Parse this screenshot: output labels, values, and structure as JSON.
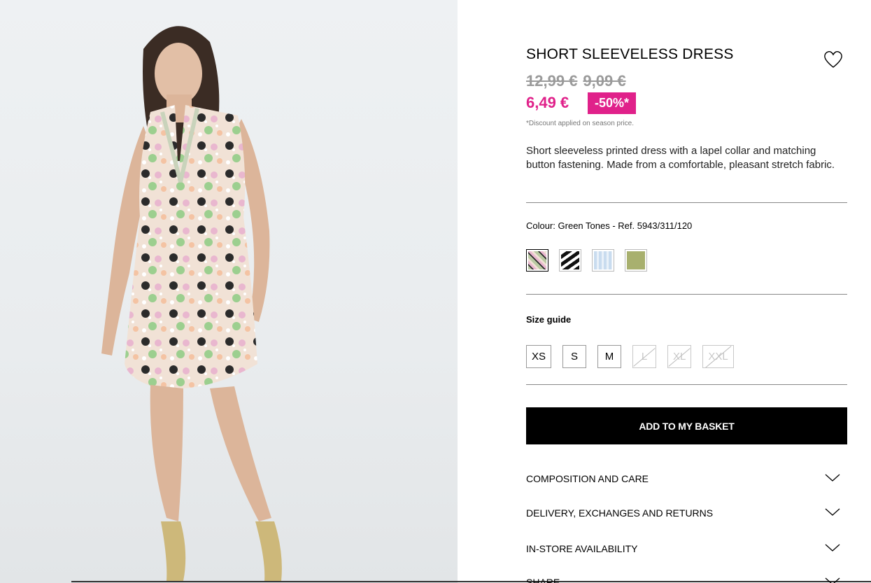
{
  "product": {
    "title": "SHORT SLEEVELESS DRESS",
    "old_price_1": "12,99 €",
    "old_price_2": "9,09 €",
    "price": "6,49 €",
    "discount": "-50%*",
    "discount_note": "*Discount applied on season price.",
    "description": "Short sleeveless printed dress with a lapel collar and matching button fastening. Made from a comfortable, pleasant stretch fabric.",
    "colour_line": "Colour: Green Tones - Ref. 5943/311/120",
    "swatches": [
      {
        "name": "Green Tones floral",
        "color": "#b9c9a2",
        "selected": true
      },
      {
        "name": "Black and white print",
        "color": "#2c2c2c",
        "selected": false
      },
      {
        "name": "Light blue stripes",
        "color": "#c9dcef",
        "selected": false
      },
      {
        "name": "Olive green",
        "color": "#a8b06e",
        "selected": false
      }
    ],
    "size_guide_label": "Size guide",
    "sizes": [
      {
        "label": "XS",
        "available": true
      },
      {
        "label": "S",
        "available": true
      },
      {
        "label": "M",
        "available": true
      },
      {
        "label": "L",
        "available": false
      },
      {
        "label": "XL",
        "available": false
      },
      {
        "label": "XXL",
        "available": false
      }
    ],
    "add_button": "ADD TO MY BASKET",
    "accordions": [
      "COMPOSITION AND CARE",
      "DELIVERY, EXCHANGES AND RETURNS",
      "IN-STORE AVAILABILITY",
      "SHARE"
    ]
  },
  "colors": {
    "accent_pink": "#e0218a",
    "button_black": "#000000"
  }
}
